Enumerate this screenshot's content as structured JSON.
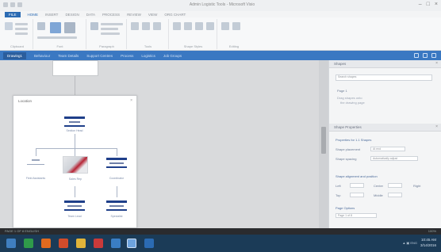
{
  "window": {
    "title": "Admin Logistic Tools - Microsoft Visio",
    "min": "–",
    "max": "□",
    "close": "×"
  },
  "ribbon_tabs": [
    "FILE",
    "HOME",
    "INSERT",
    "DESIGN",
    "DATA",
    "PROCESS",
    "REVIEW",
    "VIEW",
    "ORG CHART"
  ],
  "ribbon_groups": [
    "Clipboard",
    "Font",
    "Paragraph",
    "Tools",
    "Shape Styles",
    "Editing"
  ],
  "view_tabs": [
    "Drawing1",
    "Behaviour",
    "Team Details",
    "Support Centres",
    "Process",
    "Logistics",
    "Job Groups"
  ],
  "canvas": {
    "panel_title": "Location",
    "panel_close": "×",
    "nodes": [
      "Section Head",
      "Field Assistants",
      "Sales Rep",
      "Coordinator",
      "Team Lead",
      "Specialist"
    ]
  },
  "right_pane": {
    "section1": {
      "title": "Shapes",
      "close": "×",
      "search_placeholder": "Search shapes",
      "item": "Page 1",
      "note1": "Drag shapes onto",
      "note2": "the drawing page"
    },
    "section2": {
      "title": "Shape Properties",
      "close": "×"
    },
    "section3": {
      "title": "Properties for 1.1 Shapes"
    },
    "fields": [
      {
        "label": "Shape placement",
        "value": "At end"
      },
      {
        "label": "Shape spacing",
        "value": "Automatically adjust"
      }
    ],
    "layout_heading": "Shape alignment and position",
    "layout_opts": [
      "Left",
      "Center",
      "Right",
      "Top",
      "Middle",
      "Bottom"
    ],
    "page_heading": "Page Options",
    "page_value": "Page 1 of 8"
  },
  "status": {
    "left": "PAGE 1 OF 8   ENGLISH",
    "right": "100%"
  },
  "taskbar": {
    "time": "10:45 AM",
    "date": "3/14/2016",
    "tray": "▲ ▣ ENG"
  },
  "colors": {
    "accent": "#3a78c2",
    "node_bar": "#1f3f8a",
    "taskbar": "#1b3b57"
  }
}
